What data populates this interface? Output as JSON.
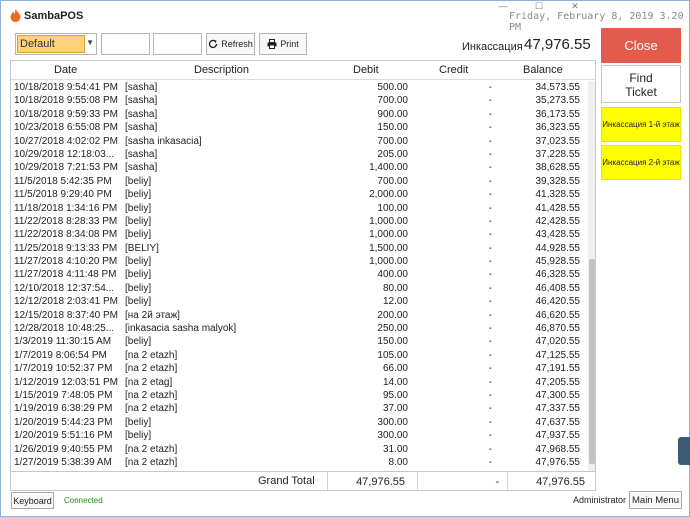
{
  "app": {
    "title": "SambaPOS",
    "datetime": "Friday, February 8, 2019 3.20 PM"
  },
  "toolbar": {
    "department": "Default",
    "refresh_label": "Refresh",
    "print_label": "Print"
  },
  "cash": {
    "label": "Инкассация",
    "value": "47,976.55"
  },
  "grid": {
    "columns": [
      "Date",
      "Description",
      "Debit",
      "Credit",
      "Balance"
    ],
    "rows": [
      [
        "10/18/2018 9:54:41 PM",
        "[sasha]",
        "500.00",
        "-",
        "34,573.55"
      ],
      [
        "10/18/2018 9:55:08 PM",
        "[sasha]",
        "700.00",
        "-",
        "35,273.55"
      ],
      [
        "10/18/2018 9:59:33 PM",
        "[sasha]",
        "900.00",
        "-",
        "36,173.55"
      ],
      [
        "10/23/2018 6:55:08 PM",
        "[sasha]",
        "150.00",
        "-",
        "36,323.55"
      ],
      [
        "10/27/2018 4:02:02 PM",
        "[sasha inkasacia]",
        "700.00",
        "-",
        "37,023.55"
      ],
      [
        "10/29/2018 12:18:03...",
        "[sasha]",
        "205.00",
        "-",
        "37,228.55"
      ],
      [
        "10/29/2018 7:21:53 PM",
        "[sasha]",
        "1,400.00",
        "-",
        "38,628.55"
      ],
      [
        "11/5/2018 5:42:35 PM",
        "[beliy]",
        "700.00",
        "-",
        "39,328.55"
      ],
      [
        "11/5/2018 9:29:40 PM",
        "[beliy]",
        "2,000.00",
        "-",
        "41,328.55"
      ],
      [
        "11/18/2018 1:34:16 PM",
        "[beliy]",
        "100.00",
        "-",
        "41,428.55"
      ],
      [
        "11/22/2018 8:28:33 PM",
        "[beliy]",
        "1,000.00",
        "-",
        "42,428.55"
      ],
      [
        "11/22/2018 8:34:08 PM",
        "[beliy]",
        "1,000.00",
        "-",
        "43,428.55"
      ],
      [
        "11/25/2018 9:13:33 PM",
        "[BELIY]",
        "1,500.00",
        "-",
        "44,928.55"
      ],
      [
        "11/27/2018 4:10:20 PM",
        "[beliy]",
        "1,000.00",
        "-",
        "45,928.55"
      ],
      [
        "11/27/2018 4:11:48 PM",
        "[beliy]",
        "400.00",
        "-",
        "46,328.55"
      ],
      [
        "12/10/2018 12:37:54...",
        "[beliy]",
        "80.00",
        "-",
        "46,408.55"
      ],
      [
        "12/12/2018 2:03:41 PM",
        "[beliy]",
        "12.00",
        "-",
        "46,420.55"
      ],
      [
        "12/15/2018 8:37:40 PM",
        "[на 2й этаж]",
        "200.00",
        "-",
        "46,620.55"
      ],
      [
        "12/28/2018 10:48:25...",
        "[inkasacia sasha malyok]",
        "250.00",
        "-",
        "46,870.55"
      ],
      [
        "1/3/2019 11:30:15 AM",
        "[beliy]",
        "150.00",
        "-",
        "47,020.55"
      ],
      [
        "1/7/2019 8:06:54 PM",
        "[na 2 etazh]",
        "105.00",
        "-",
        "47,125.55"
      ],
      [
        "1/7/2019 10:52:37 PM",
        "[na 2 etazh]",
        "66.00",
        "-",
        "47,191.55"
      ],
      [
        "1/12/2019 12:03:51 PM",
        "[na 2 etag]",
        "14.00",
        "-",
        "47,205.55"
      ],
      [
        "1/15/2019 7:48:05 PM",
        "[na 2 etazh]",
        "95.00",
        "-",
        "47,300.55"
      ],
      [
        "1/19/2019 6:38:29 PM",
        "[na 2 etazh]",
        "37.00",
        "-",
        "47,337.55"
      ],
      [
        "1/20/2019 5:44:23 PM",
        "[beliy]",
        "300.00",
        "-",
        "47,637.55"
      ],
      [
        "1/20/2019 5:51:16 PM",
        "[beliy]",
        "300.00",
        "-",
        "47,937.55"
      ],
      [
        "1/26/2019 9:40:55 PM",
        "[na 2 etazh]",
        "31.00",
        "-",
        "47,968.55"
      ],
      [
        "1/27/2019 5:38:39 AM",
        "[na 2 etazh]",
        "8.00",
        "-",
        "47,976.55"
      ]
    ],
    "total": {
      "label": "Grand Total",
      "debit": "47,976.55",
      "credit": "-",
      "balance": "47,976.55"
    }
  },
  "side": {
    "close_label": "Close",
    "find_label_1": "Find",
    "find_label_2": "Ticket",
    "cash_floor1": "Инкассация 1-й этаж",
    "cash_floor2": "Инкассация 2-й этаж"
  },
  "footer": {
    "keyboard_label": "Keyboard",
    "status": "Connected",
    "user": "Administrator",
    "main_menu_label": "Main Menu"
  },
  "colors": {
    "close": "#e35b4c",
    "accent_yellow": "#ffff00",
    "connected": "#1a8f1a",
    "selected": "#fed27c"
  }
}
